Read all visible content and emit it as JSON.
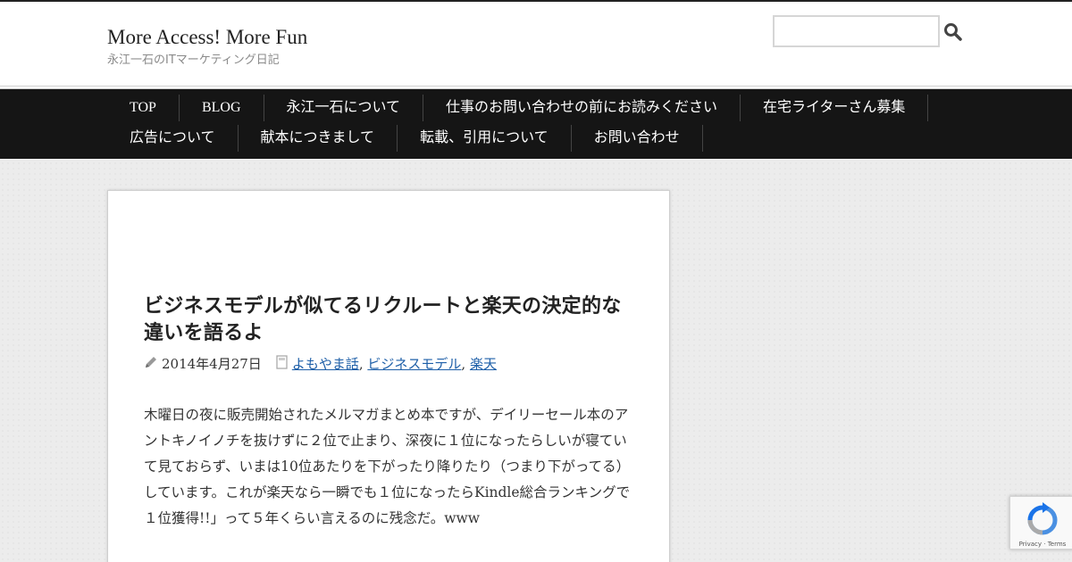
{
  "site": {
    "title": "More Access! More Fun",
    "description": "永江一石のITマーケティング日記"
  },
  "search": {
    "placeholder": "",
    "icon": "search-icon"
  },
  "nav": {
    "row1": [
      "TOP",
      "BLOG",
      "永江一石について",
      "仕事のお問い合わせの前にお読みください",
      "在宅ライターさん募集"
    ],
    "row2": [
      "広告について",
      "献本につきまして",
      "転載、引用について",
      "お問い合わせ"
    ]
  },
  "post": {
    "title": "ビジネスモデルが似てるリクルートと楽天の決定的な違いを語るよ",
    "date": "2014年4月27日",
    "categories": [
      "よもやま話",
      "ビジネスモデル",
      "楽天"
    ],
    "body": "木曜日の夜に販売開始されたメルマガまとめ本ですが、デイリーセール本のアントキノイノチを抜けずに２位で止まり、深夜に１位になったらしいが寝ていて見ておらず、いまは10位あたりを下がったり降りたり（つまり下がってる）しています。これが楽天なら一瞬でも１位になったらKindle総合ランキングで１位獲得!!」って５年くらい言えるのに残念だ。www"
  },
  "colors": {
    "nav_bg": "#151515",
    "link": "#1e5fa8",
    "accent": "#222222"
  }
}
